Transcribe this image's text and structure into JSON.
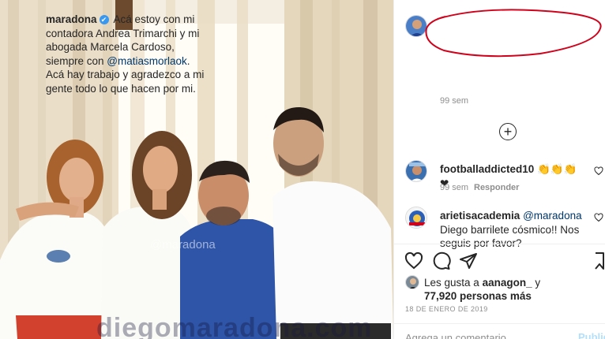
{
  "post": {
    "username": "maradona",
    "verified_icon": "✔",
    "caption_text": "Acá estoy con mi contadora Andrea Trimarchi y mi abogada Marcela Cardoso, siempre con ",
    "caption_mention": "@matiasmorlaok",
    "caption_tail": ". Acá hay trabajo y agradezco a mi gente todo lo que hacen por mi.",
    "caption_age": "99 sem"
  },
  "load_more_icon": "+",
  "comments": [
    {
      "username": "footballaddicted10",
      "text": "👏👏👏❤",
      "age": "99 sem",
      "reply_label": "Responder"
    },
    {
      "username": "arietisacademia",
      "mention": "@maradona",
      "text": "Diego barrilete cósmico!! Nos seguis por favor?"
    }
  ],
  "photo": {
    "watermark": "@maradona",
    "bottom_watermark": "diegomaradona.com"
  },
  "likes": {
    "prefix": "Les gusta a ",
    "user": "aanagon_",
    "connector": " y",
    "count": "77,920",
    "suffix": " personas más"
  },
  "date": "18 DE ENERO DE 2019",
  "comment_box": {
    "placeholder": "Agrega un comentario...",
    "post_label": "Publicar"
  },
  "colors": {
    "accent": "#3897f0",
    "annotation": "#d0021b"
  },
  "icons": [
    "heart-icon",
    "comment-icon",
    "share-icon",
    "bookmark-icon",
    "add-comments-icon"
  ]
}
